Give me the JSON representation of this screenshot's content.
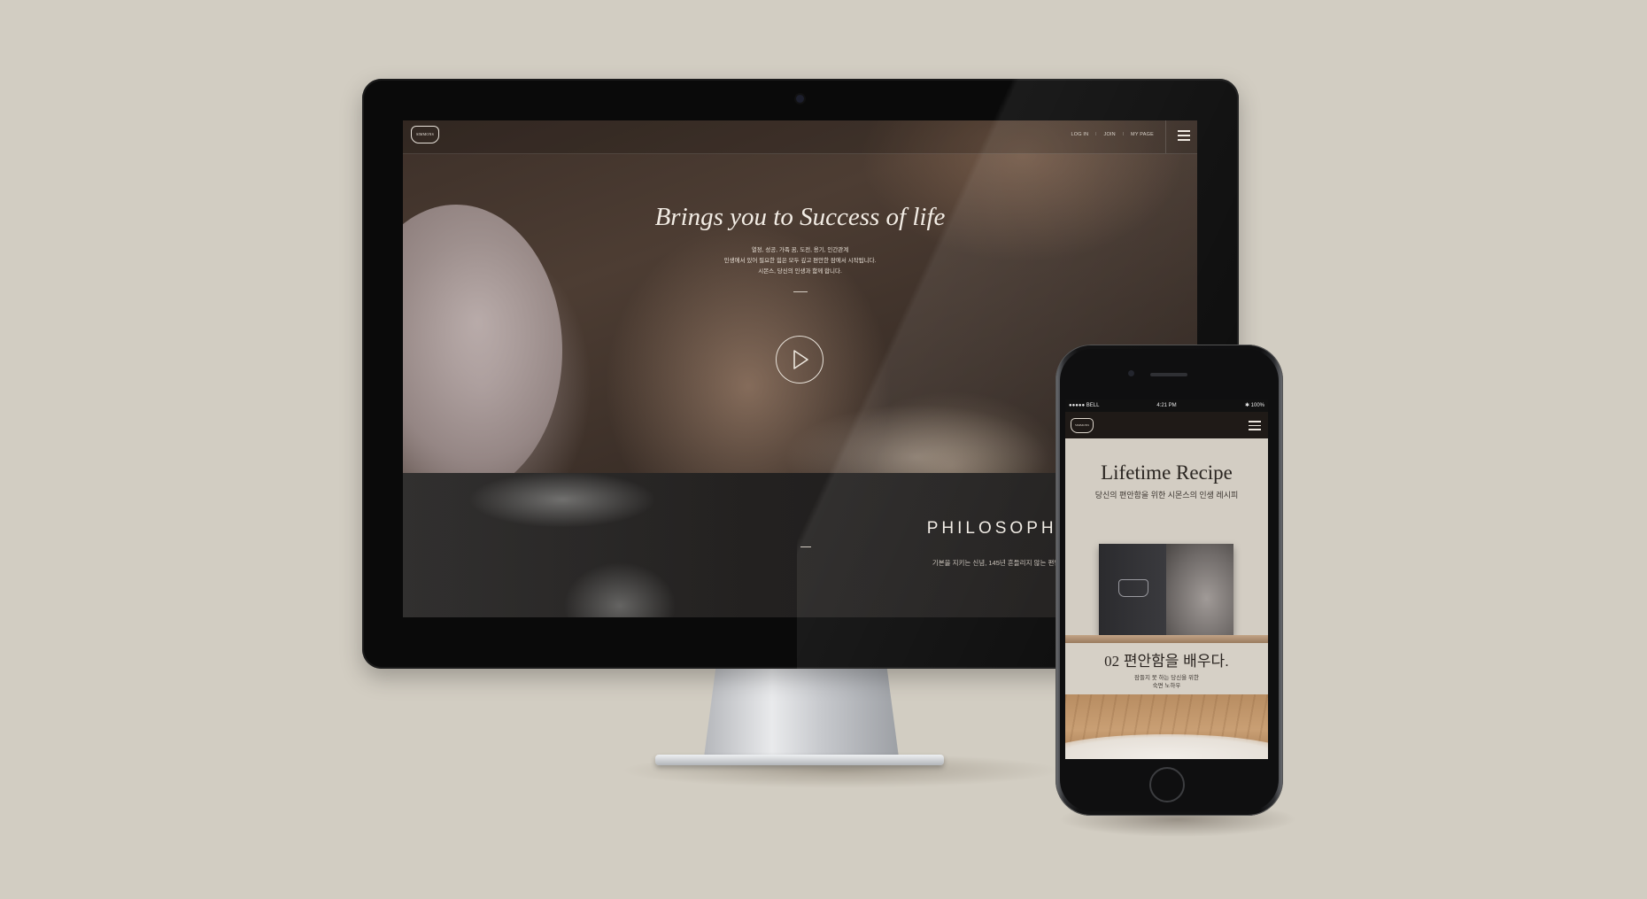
{
  "desktop": {
    "logo_text": "SIMMONS",
    "nav_links": [
      "LOG IN",
      "JOIN",
      "MY PAGE"
    ],
    "nav_separator": "I",
    "hero": {
      "title": "Brings you to Success of life",
      "desc_lines": [
        "열정, 성공, 가족 꿈, 도전, 용기, 인간관계",
        "인생에서 있어 필요한 힘은 모두 깊고 편안한 잠에서 시작됩니다.",
        "시몬스, 당신의 인생과 함께 합니다."
      ]
    },
    "philosophy": {
      "title": "PHILOSOPHY",
      "subtitle": "기본을 지키는 신념, 145년 흔들리지 않는 편안함"
    }
  },
  "mobile": {
    "status": {
      "carrier": "●●●●● BELL",
      "time": "4:21 PM",
      "battery": "✱ 100%"
    },
    "logo_text": "SIMMONS",
    "recipe": {
      "title": "Lifetime Recipe",
      "subtitle": "당신의 편안함을 위한 시몬스의 인생 레시피"
    },
    "section": {
      "number": "02",
      "heading": "편안함을 배우다.",
      "desc_lines": [
        "잠들지 못 하는 당신을 위한",
        "숙면 노하우"
      ]
    }
  }
}
